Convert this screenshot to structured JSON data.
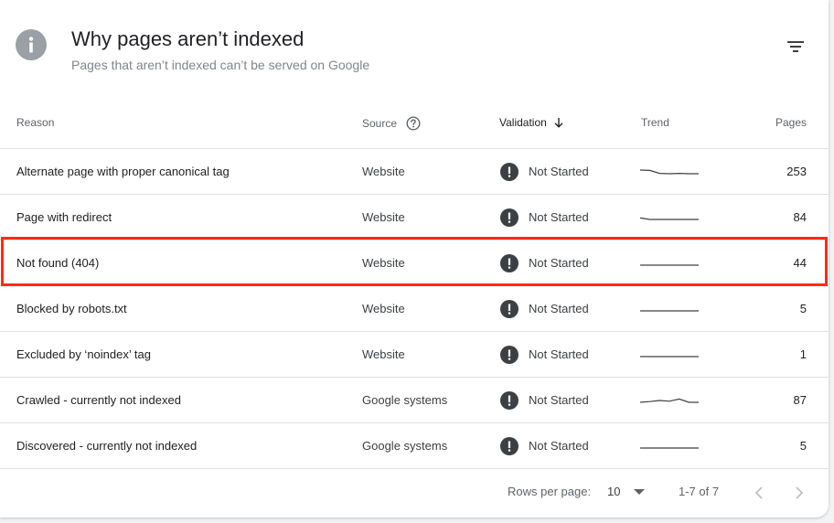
{
  "header": {
    "title": "Why pages aren’t indexed",
    "subtitle": "Pages that aren’t indexed can’t be served on Google",
    "icon": "info-icon",
    "filter_icon": "filter-icon"
  },
  "columns": {
    "reason": "Reason",
    "source": "Source",
    "validation": "Validation",
    "trend": "Trend",
    "pages": "Pages"
  },
  "rows": [
    {
      "reason": "Alternate page with proper canonical tag",
      "source": "Website",
      "validation": "Not Started",
      "pages": "253",
      "trend": [
        1.0,
        0.9,
        0.1,
        0.0,
        0.1,
        0.0,
        0.0
      ]
    },
    {
      "reason": "Page with redirect",
      "source": "Website",
      "validation": "Not Started",
      "pages": "84",
      "trend": [
        0.4,
        0.0,
        0.0,
        0.0,
        0.0,
        0.0,
        0.0
      ]
    },
    {
      "reason": "Not found (404)",
      "source": "Website",
      "validation": "Not Started",
      "pages": "44",
      "trend": [
        0.0,
        0.0,
        0.0,
        0.0,
        0.0,
        0.0,
        0.0
      ]
    },
    {
      "reason": "Blocked by robots.txt",
      "source": "Website",
      "validation": "Not Started",
      "pages": "5",
      "trend": [
        0.0,
        0.0,
        0.0,
        0.0,
        0.0,
        0.0,
        0.0
      ]
    },
    {
      "reason": "Excluded by ‘noindex’ tag",
      "source": "Website",
      "validation": "Not Started",
      "pages": "1",
      "trend": [
        0.0,
        0.0,
        0.0,
        0.0,
        0.0,
        0.0,
        0.0
      ]
    },
    {
      "reason": "Crawled - currently not indexed",
      "source": "Google systems",
      "validation": "Not Started",
      "pages": "87",
      "trend": [
        0.0,
        0.2,
        0.5,
        0.3,
        0.9,
        0.0,
        0.0
      ]
    },
    {
      "reason": "Discovered - currently not indexed",
      "source": "Google systems",
      "validation": "Not Started",
      "pages": "5",
      "trend": [
        0.0,
        0.0,
        0.0,
        0.0,
        0.0,
        0.0,
        0.0
      ]
    }
  ],
  "footer": {
    "rows_per_page_label": "Rows per page:",
    "rows_per_page_value": "10",
    "range": "1-7 of 7"
  },
  "colors": {
    "highlight": "#ff2a12",
    "status_icon": "#3c4043",
    "trend_line": "#3c4043"
  }
}
